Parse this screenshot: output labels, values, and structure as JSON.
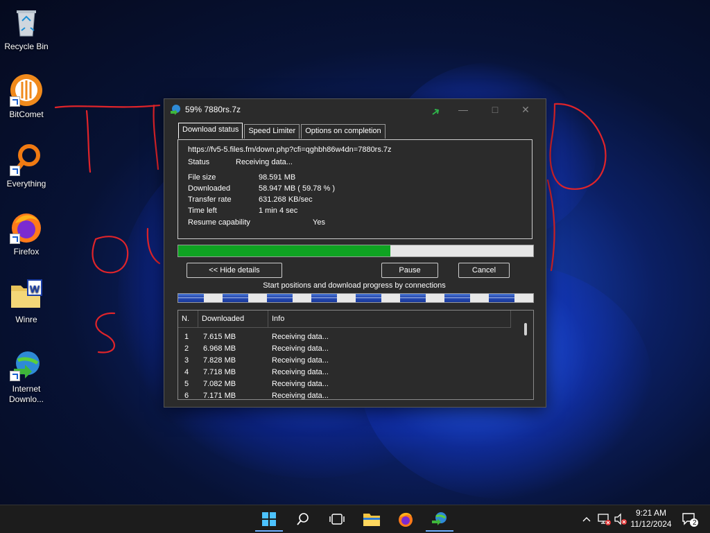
{
  "desktop": {
    "icons": [
      {
        "label": "Recycle Bin",
        "icon": "recycle-bin-icon"
      },
      {
        "label": "BitComet",
        "icon": "bitcomet-icon"
      },
      {
        "label": "Everything",
        "icon": "everything-search-icon"
      },
      {
        "label": "Firefox",
        "icon": "firefox-icon"
      },
      {
        "label": "Winre",
        "icon": "folder-icon"
      },
      {
        "label": "Internet Downlo...",
        "icon": "internet-download-manager-icon"
      }
    ]
  },
  "window": {
    "title": "59% 7880rs.7z",
    "tabs": [
      {
        "label": "Download status",
        "active": true
      },
      {
        "label": "Speed Limiter",
        "active": false
      },
      {
        "label": "Options on completion",
        "active": false
      }
    ],
    "url": "https://fv5-5.files.fm/down.php?cfi=qghbh86w4dn=7880rs.7z",
    "status_label": "Status",
    "status_value": "Receiving data...",
    "info": [
      {
        "key": "File size",
        "value": "98.591  MB"
      },
      {
        "key": "Downloaded",
        "value": "58.947  MB  ( 59.78 % )"
      },
      {
        "key": "Transfer rate",
        "value": "631.268  KB/sec"
      },
      {
        "key": "Time left",
        "value": "1 min 4 sec"
      },
      {
        "key": "Resume capability",
        "value": "Yes"
      }
    ],
    "progress_fraction": 0.5978,
    "buttons": {
      "hide_details": "<< Hide details",
      "pause": "Pause",
      "cancel": "Cancel"
    },
    "connections_label": "Start positions and download progress by connections",
    "connections_count": 8,
    "list": {
      "columns": [
        "N.",
        "Downloaded",
        "Info"
      ],
      "rows": [
        {
          "n": "1",
          "downloaded": "7.615  MB",
          "info": "Receiving data..."
        },
        {
          "n": "2",
          "downloaded": "6.968  MB",
          "info": "Receiving data..."
        },
        {
          "n": "3",
          "downloaded": "7.828  MB",
          "info": "Receiving data..."
        },
        {
          "n": "4",
          "downloaded": "7.718  MB",
          "info": "Receiving data..."
        },
        {
          "n": "5",
          "downloaded": "7.082  MB",
          "info": "Receiving data..."
        },
        {
          "n": "6",
          "downloaded": "7.171  MB",
          "info": "Receiving data..."
        }
      ]
    }
  },
  "taskbar": {
    "items": [
      "start-icon",
      "search-icon",
      "task-view-icon",
      "file-explorer-icon",
      "firefox-icon",
      "internet-download-manager-icon"
    ],
    "clock_time": "9:21 AM",
    "clock_date": "11/12/2024",
    "notification_count": "2"
  },
  "colors": {
    "progress": "#0fa322",
    "accent": "#6fb0ff",
    "window_bg": "#2b2b2b"
  }
}
